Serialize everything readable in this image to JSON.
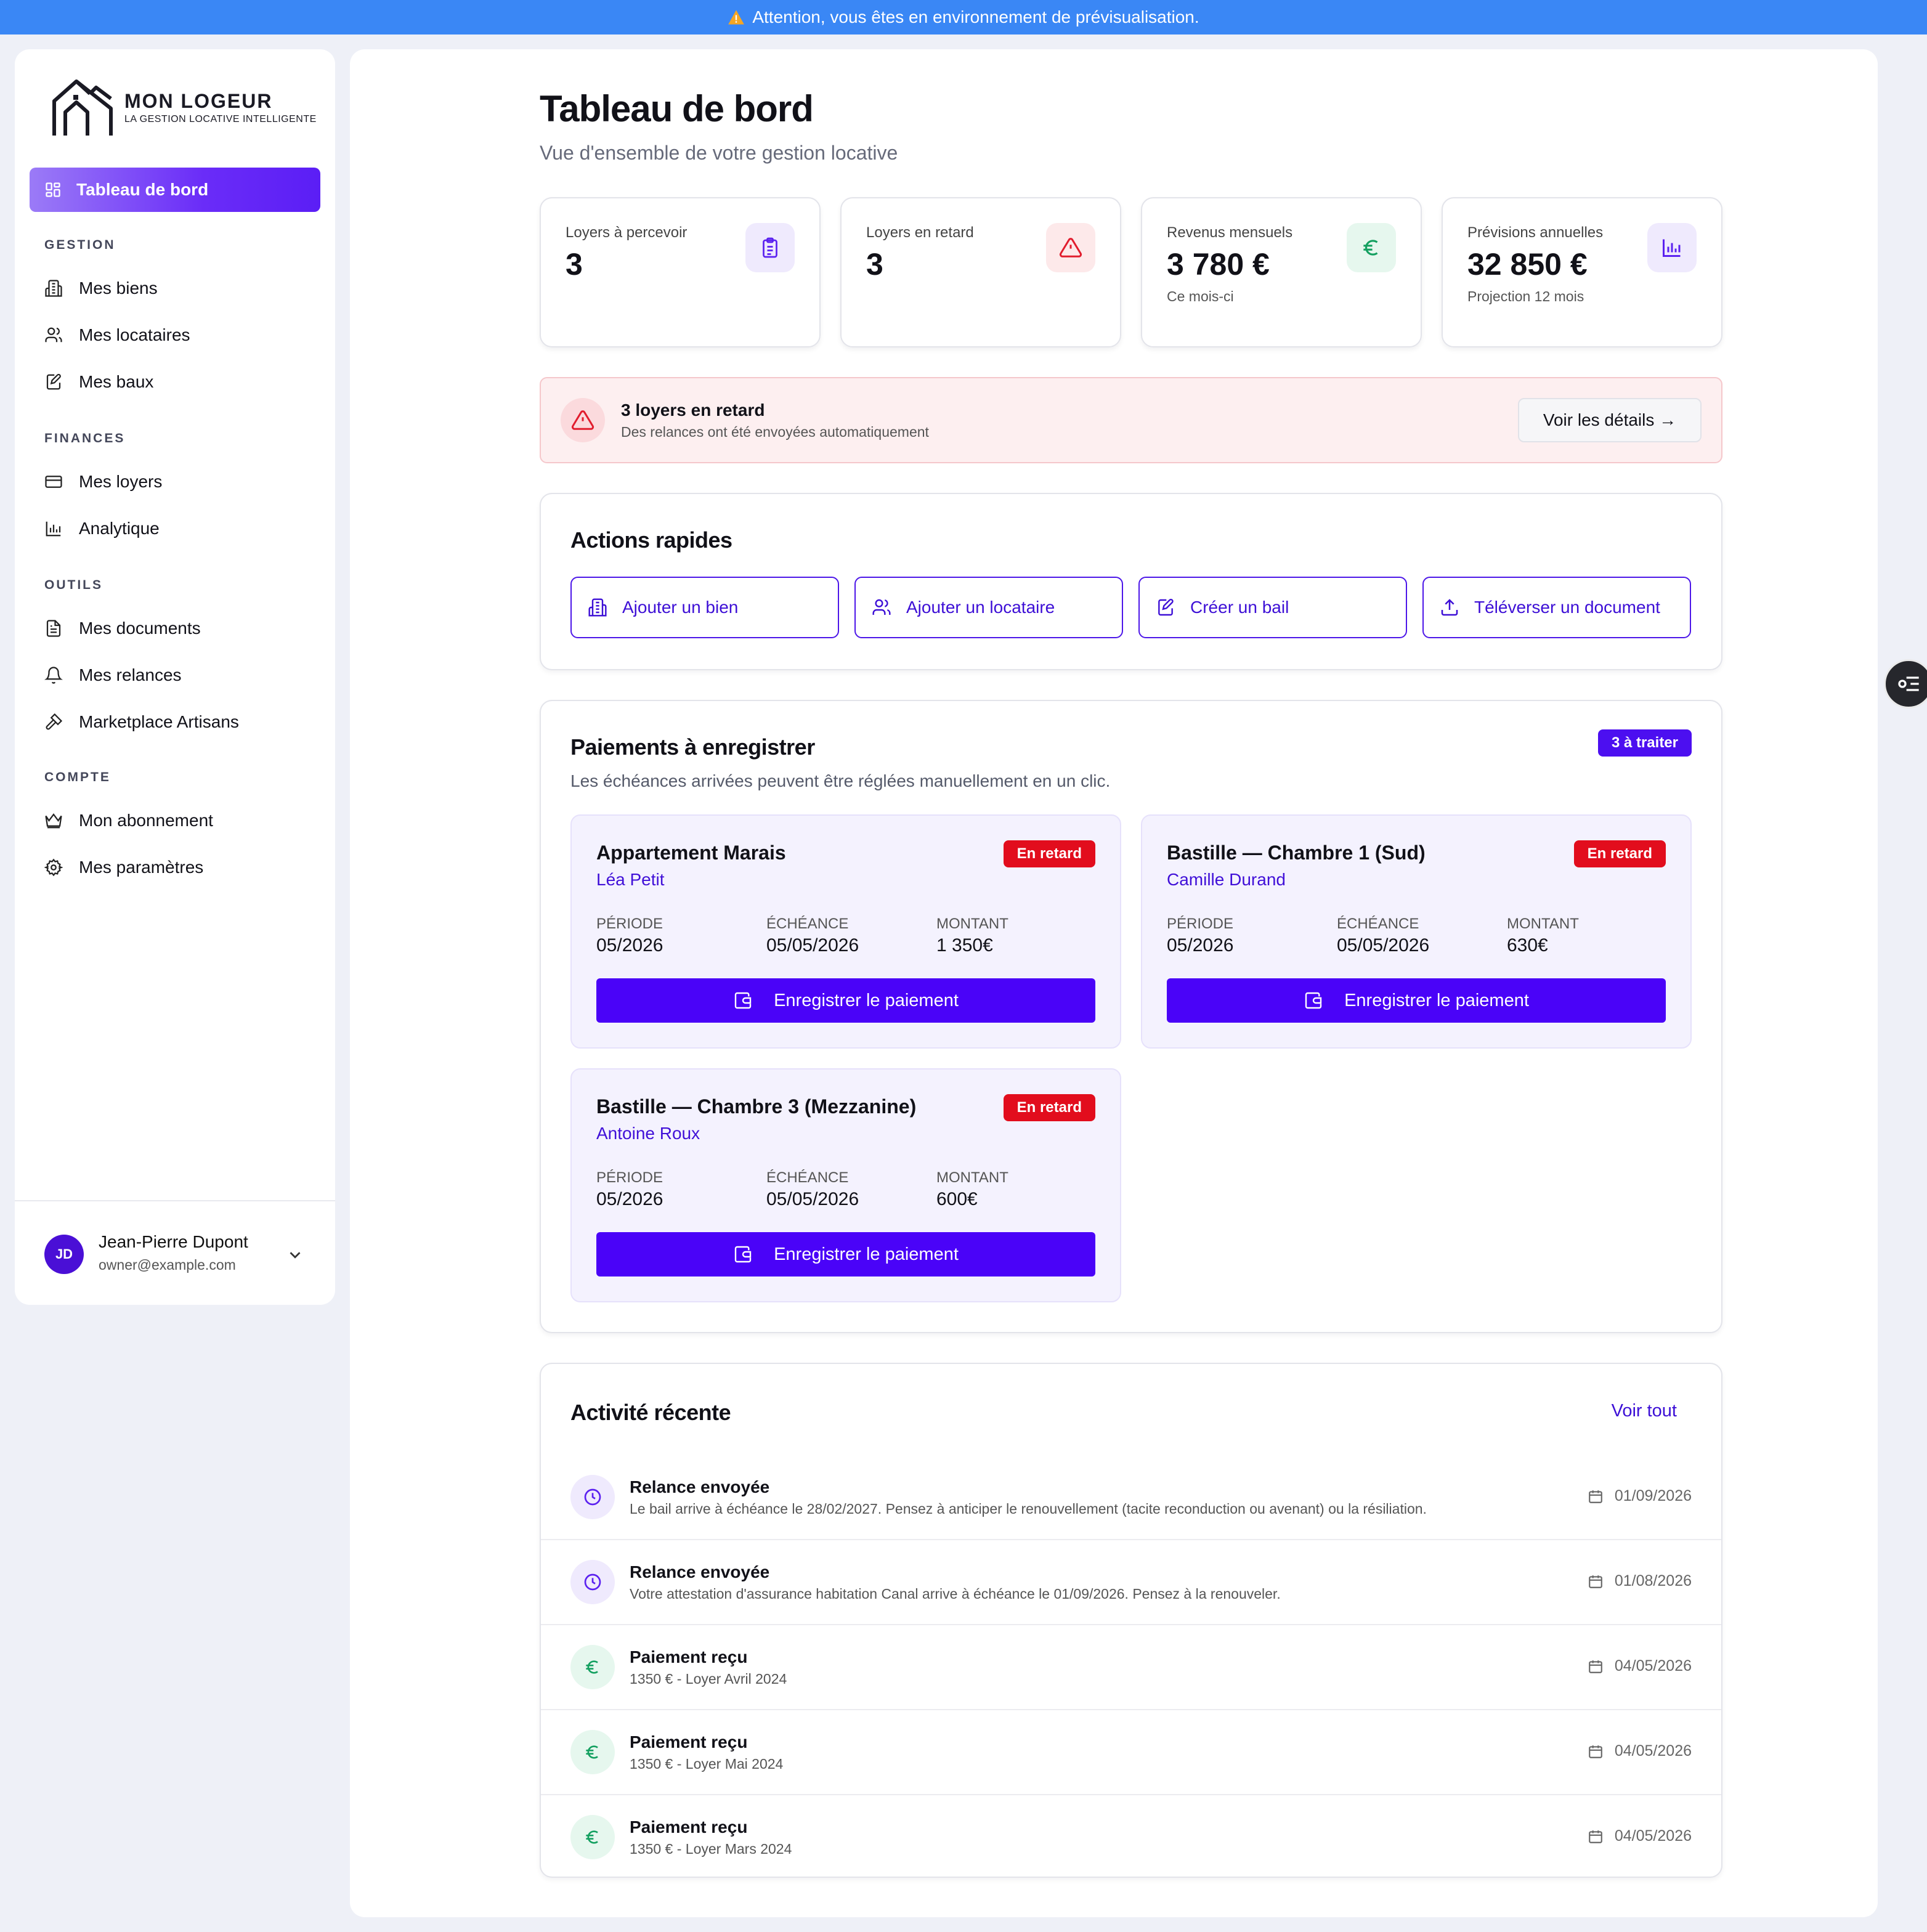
{
  "banner": {
    "icon": "warning-icon",
    "text": "Attention, vous êtes en environnement de prévisualisation."
  },
  "logo": {
    "title": "MON LOGEUR",
    "subtitle": "LA GESTION LOCATIVE INTELLIGENTE"
  },
  "sidebar": {
    "active": {
      "label": "Tableau de bord",
      "icon": "dashboard-icon"
    },
    "sections": [
      {
        "title": "GESTION",
        "items": [
          {
            "label": "Mes biens",
            "icon": "building-icon"
          },
          {
            "label": "Mes locataires",
            "icon": "users-icon"
          },
          {
            "label": "Mes baux",
            "icon": "edit-doc-icon"
          }
        ]
      },
      {
        "title": "FINANCES",
        "items": [
          {
            "label": "Mes loyers",
            "icon": "credit-card-icon"
          },
          {
            "label": "Analytique",
            "icon": "bar-chart-icon"
          }
        ]
      },
      {
        "title": "OUTILS",
        "items": [
          {
            "label": "Mes documents",
            "icon": "document-icon"
          },
          {
            "label": "Mes relances",
            "icon": "bell-icon"
          },
          {
            "label": "Marketplace Artisans",
            "icon": "hammer-icon"
          }
        ]
      },
      {
        "title": "COMPTE",
        "items": [
          {
            "label": "Mon abonnement",
            "icon": "crown-icon"
          },
          {
            "label": "Mes paramètres",
            "icon": "gear-icon"
          }
        ]
      }
    ],
    "user": {
      "initials": "JD",
      "name": "Jean-Pierre Dupont",
      "email": "owner@example.com"
    }
  },
  "header": {
    "title": "Tableau de bord",
    "subtitle": "Vue d'ensemble de votre gestion locative"
  },
  "stats": [
    {
      "label": "Loyers à percevoir",
      "value": "3",
      "note": "",
      "icon": "clipboard-icon",
      "color": "#5b21f0",
      "bg": "#efeafd"
    },
    {
      "label": "Loyers en retard",
      "value": "3",
      "note": "",
      "icon": "warning-icon",
      "color": "#e11d2e",
      "bg": "#fde9ea"
    },
    {
      "label": "Revenus mensuels",
      "value": "3 780 €",
      "note": "Ce mois-ci",
      "icon": "euro-icon",
      "color": "#14a060",
      "bg": "#e6f7ee"
    },
    {
      "label": "Prévisions annuelles",
      "value": "32 850 €",
      "note": "Projection 12 mois",
      "icon": "bar-chart-icon",
      "color": "#5b21f0",
      "bg": "#efeafd"
    }
  ],
  "alert": {
    "title": "3 loyers en retard",
    "subtitle": "Des relances ont été envoyées automatiquement",
    "button": "Voir les détails →"
  },
  "quick_actions": {
    "title": "Actions rapides",
    "items": [
      {
        "label": "Ajouter un bien",
        "icon": "building-icon"
      },
      {
        "label": "Ajouter un locataire",
        "icon": "users-icon"
      },
      {
        "label": "Créer un bail",
        "icon": "edit-doc-icon"
      },
      {
        "label": "Téléverser un document",
        "icon": "upload-icon"
      }
    ]
  },
  "payments": {
    "title": "Paiements à enregistrer",
    "badge": "3 à traiter",
    "subtitle": "Les échéances arrivées peuvent être réglées manuellement en un clic.",
    "labels": {
      "period": "PÉRIODE",
      "due": "ÉCHÉANCE",
      "amount": "MONTANT",
      "button": "Enregistrer le paiement"
    },
    "items": [
      {
        "title": "Appartement Marais",
        "tenant": "Léa Petit",
        "status": "En retard",
        "period": "05/2026",
        "due": "05/05/2026",
        "amount": "1 350€"
      },
      {
        "title": "Bastille — Chambre 1 (Sud)",
        "tenant": "Camille Durand",
        "status": "En retard",
        "period": "05/2026",
        "due": "05/05/2026",
        "amount": "630€"
      },
      {
        "title": "Bastille — Chambre 3 (Mezzanine)",
        "tenant": "Antoine Roux",
        "status": "En retard",
        "period": "05/2026",
        "due": "05/05/2026",
        "amount": "600€"
      }
    ]
  },
  "activity": {
    "title": "Activité récente",
    "link": "Voir tout",
    "items": [
      {
        "type": "clock-icon",
        "title": "Relance envoyée",
        "desc": "Le bail arrive à échéance le 28/02/2027. Pensez à anticiper le renouvellement (tacite reconduction ou avenant) ou la résiliation.",
        "date": "01/09/2026"
      },
      {
        "type": "clock-icon",
        "title": "Relance envoyée",
        "desc": "Votre attestation d'assurance habitation Canal arrive à échéance le 01/09/2026. Pensez à la renouveler.",
        "date": "01/08/2026"
      },
      {
        "type": "euro-icon",
        "title": "Paiement reçu",
        "desc": "1350 € - Loyer Avril 2024",
        "date": "04/05/2026"
      },
      {
        "type": "euro-icon",
        "title": "Paiement reçu",
        "desc": "1350 € - Loyer Mai 2024",
        "date": "04/05/2026"
      },
      {
        "type": "euro-icon",
        "title": "Paiement reçu",
        "desc": "1350 € - Loyer Mars 2024",
        "date": "04/05/2026"
      }
    ]
  },
  "colors": {
    "accent": "#4a03f8",
    "banner": "#3a87f5",
    "danger": "#e20d1d",
    "success": "#14a060"
  }
}
